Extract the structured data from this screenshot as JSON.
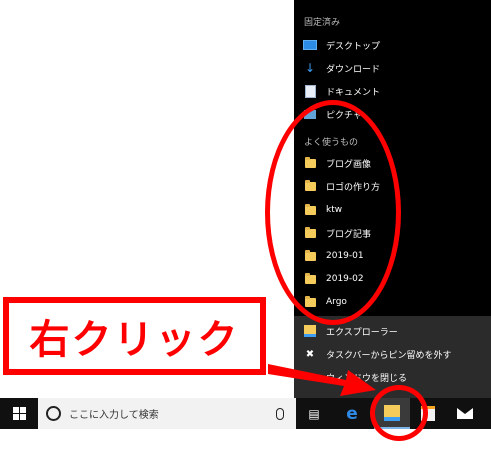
{
  "jumplist": {
    "pinned_header": "固定済み",
    "pinned": [
      {
        "label": "デスクトップ",
        "icon": "desktop-icon"
      },
      {
        "label": "ダウンロード",
        "icon": "download-icon"
      },
      {
        "label": "ドキュメント",
        "icon": "document-icon"
      },
      {
        "label": "ピクチャ",
        "icon": "pictures-icon"
      }
    ],
    "frequent_header": "よく使うもの",
    "frequent": [
      {
        "label": "ブログ画像"
      },
      {
        "label": "ロゴの作り方"
      },
      {
        "label": "ktw"
      },
      {
        "label": "ブログ記事"
      },
      {
        "label": "2019-01"
      },
      {
        "label": "2019-02"
      },
      {
        "label": "Argo"
      }
    ],
    "actions": [
      {
        "label": "エクスプローラー",
        "icon": "explorer-icon"
      },
      {
        "label": "タスクバーからピン留めを外す",
        "icon": "unpin-icon"
      },
      {
        "label": "ウィンドウを閉じる",
        "icon": "close-icon"
      }
    ]
  },
  "taskbar": {
    "search_placeholder": "ここに入力して検索",
    "apps": [
      "task-view-icon",
      "edge-icon",
      "file-explorer-icon",
      "store-icon",
      "mail-icon"
    ]
  },
  "annotation": {
    "callout_text": "右クリック",
    "color": "#ff0000"
  }
}
